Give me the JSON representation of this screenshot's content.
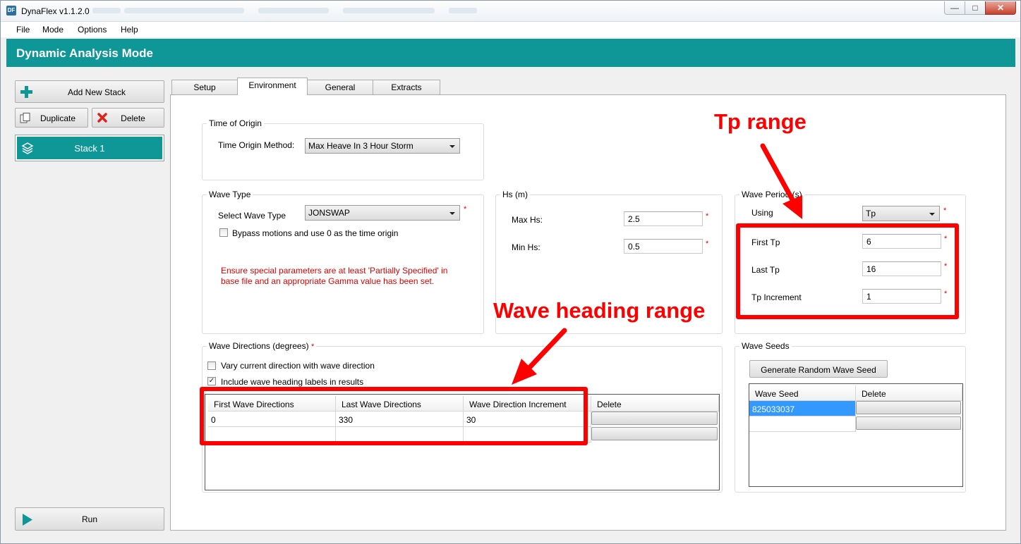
{
  "window": {
    "title": "DynaFlex v1.1.2.0",
    "app_icon": "DF",
    "min_glyph": "—",
    "max_glyph": "□",
    "close_glyph": "✕"
  },
  "menu": [
    "File",
    "Mode",
    "Options",
    "Help"
  ],
  "header": {
    "title": "Dynamic Analysis Mode"
  },
  "sidebar": {
    "add_stack": "Add New Stack",
    "duplicate": "Duplicate",
    "delete": "Delete",
    "stacks": [
      "Stack 1"
    ],
    "run": "Run"
  },
  "tabs": [
    "Setup",
    "Environment",
    "General",
    "Extracts"
  ],
  "active_tab": "Environment",
  "time_origin": {
    "group_title": "Time of Origin",
    "method_label": "Time Origin Method:",
    "method_value": "Max Heave In 3 Hour Storm"
  },
  "wave_type": {
    "group_title": "Wave Type",
    "select_label": "Select Wave Type",
    "select_value": "JONSWAP",
    "required_mark": "*",
    "bypass_label": "Bypass motions and use 0 as the time origin",
    "bypass_checked": false,
    "warning_line1": "Ensure special parameters are at least 'Partially Specified' in",
    "warning_line2": "base file and an appropriate Gamma value has been set."
  },
  "hs": {
    "group_title": "Hs (m)",
    "max_label": "Max Hs:",
    "max_value": "2.5",
    "min_label": "Min Hs:",
    "min_value": "0.5",
    "required_mark": "*"
  },
  "wave_period": {
    "group_title": "Wave Period (s)",
    "using_label": "Using",
    "using_value": "Tp",
    "first_label": "First Tp",
    "first_value": "6",
    "last_label": "Last Tp",
    "last_value": "16",
    "inc_label": "Tp Increment",
    "inc_value": "1",
    "required_mark": "*"
  },
  "wave_directions": {
    "group_title": "Wave Directions (degrees)",
    "required_mark": "*",
    "vary_label": "Vary current direction with wave direction",
    "vary_checked": false,
    "include_label": "Include wave heading labels in results",
    "include_checked": true,
    "check_glyph": "✓",
    "columns": [
      "First Wave Directions",
      "Last Wave Directions",
      "Wave Direction Increment",
      "Delete"
    ],
    "rows": [
      {
        "first": "0",
        "last": "330",
        "inc": "30"
      },
      {
        "first": "",
        "last": "",
        "inc": ""
      }
    ]
  },
  "wave_seeds": {
    "group_title": "Wave Seeds",
    "generate_label": "Generate Random Wave Seed",
    "columns": [
      "Wave Seed",
      "Delete"
    ],
    "rows": [
      "825033037",
      ""
    ]
  },
  "annotations": {
    "tp_range": "Tp range",
    "wave_heading_range": "Wave heading range",
    "color": "#ff0000"
  },
  "colors": {
    "accent": "#0f9696",
    "required": "#e00000",
    "selection": "#3399ff"
  },
  "icons": [
    "app-icon",
    "plus-icon",
    "duplicate-icon",
    "delete-x-icon",
    "layers-icon",
    "play-icon",
    "dropdown-arrow-icon",
    "checkbox-check-icon"
  ]
}
